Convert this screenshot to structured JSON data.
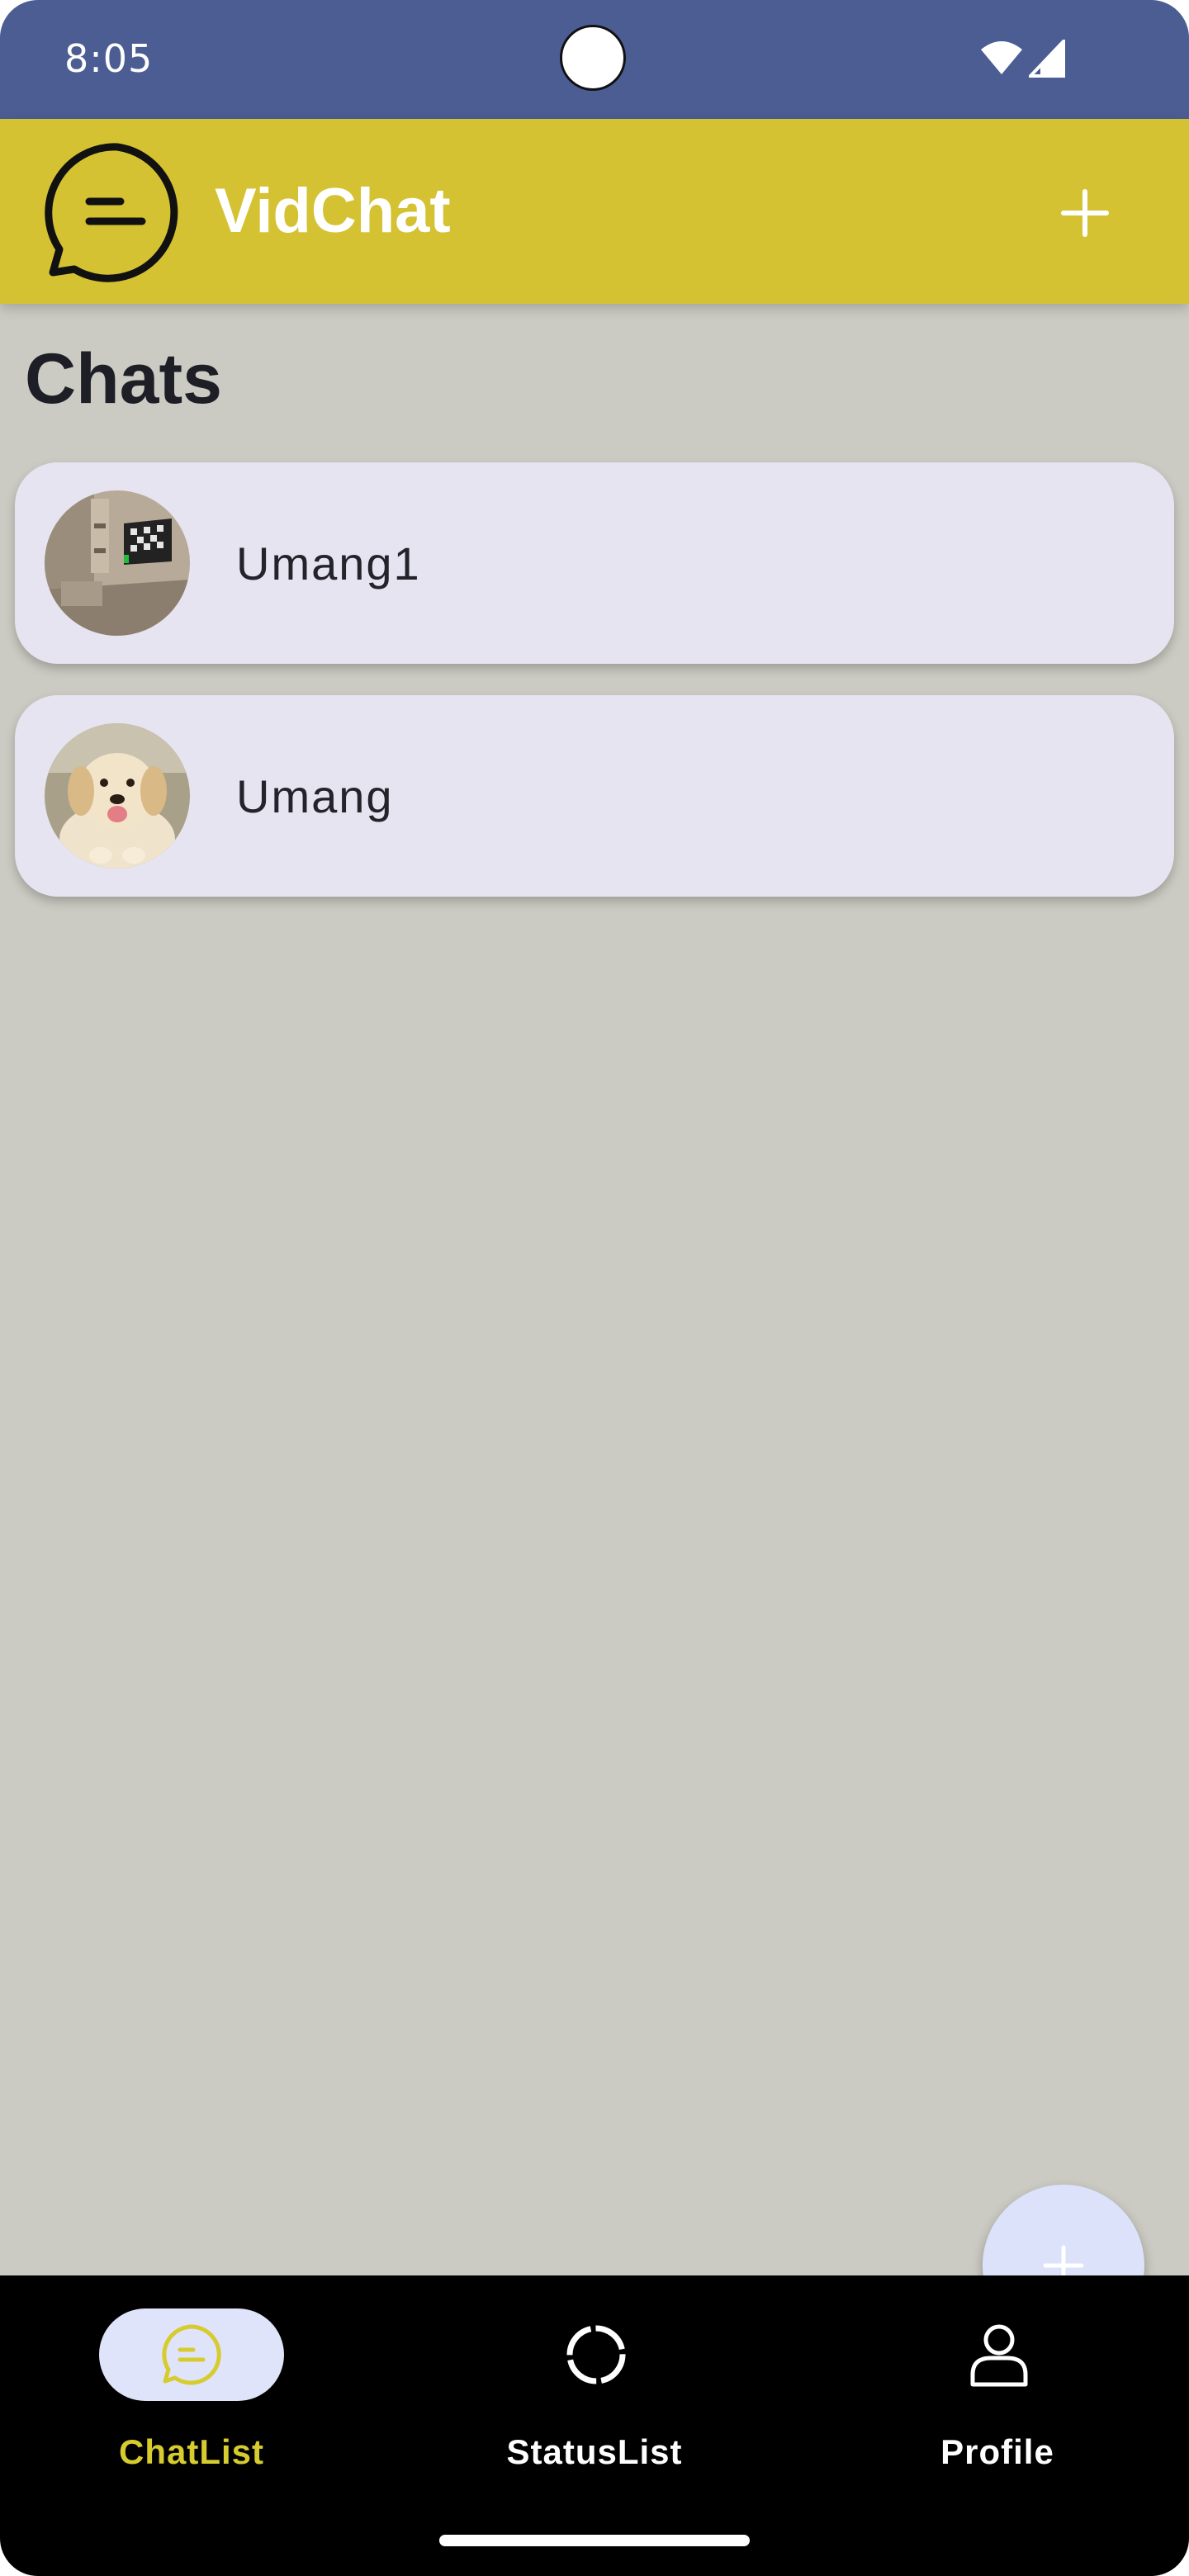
{
  "status_bar": {
    "time": "8:05",
    "icons": [
      "wifi-icon",
      "signal-icon"
    ]
  },
  "app_bar": {
    "title": "VidChat",
    "logo_icon": "chat-bubble-logo-icon",
    "action_icon": "plus-icon"
  },
  "main": {
    "section_title": "Chats",
    "chats": [
      {
        "name": "Umang1",
        "avatar": "room-photo-avatar"
      },
      {
        "name": "Umang",
        "avatar": "puppy-photo-avatar"
      }
    ]
  },
  "fab": {
    "icon": "plus-icon"
  },
  "bottom_nav": {
    "items": [
      {
        "label": "ChatList",
        "icon": "chat-bubble-icon",
        "selected": true
      },
      {
        "label": "StatusList",
        "icon": "status-ring-icon",
        "selected": false
      },
      {
        "label": "Profile",
        "icon": "person-icon",
        "selected": false
      }
    ]
  },
  "colors": {
    "status_bar": "#4b5d93",
    "app_bar": "#d4c232",
    "background": "#cbcbc3",
    "card": "#e6e4f0",
    "nav_selected_label": "#d6cc2e",
    "nav_pill": "#e0e4fa",
    "fab": "#dde2fb"
  }
}
